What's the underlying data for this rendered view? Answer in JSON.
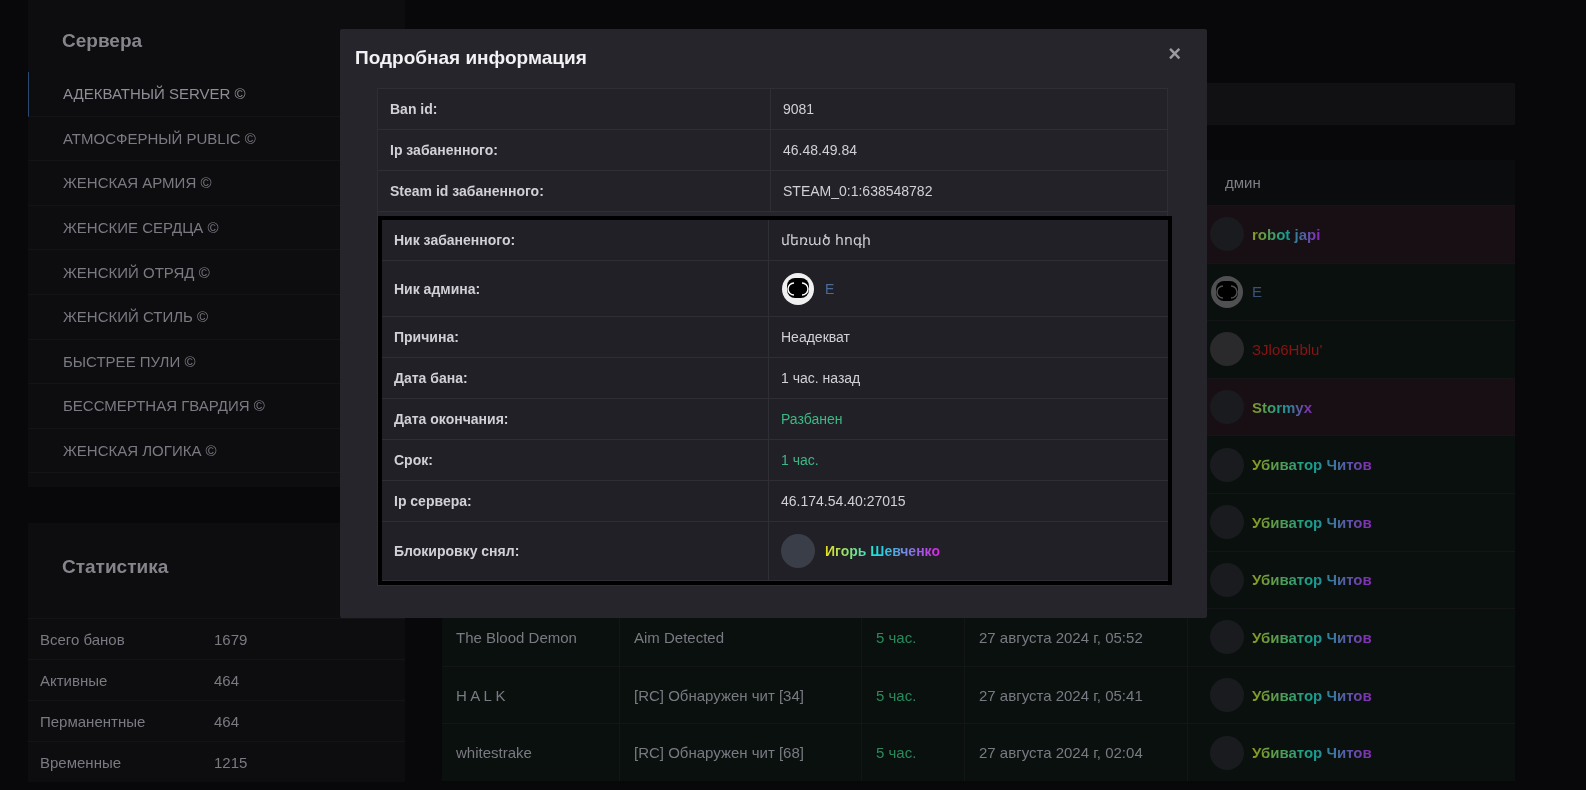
{
  "sidebar": {
    "servers": {
      "title": "Сервера",
      "items": [
        {
          "label": "АДЕКВАТНЫЙ SERVER ©",
          "selected": true
        },
        {
          "label": "АТМОСФЕРНЫЙ PUBLIC ©",
          "selected": false
        },
        {
          "label": "ЖЕНСКАЯ АРМИЯ ©",
          "selected": false
        },
        {
          "label": "ЖЕНСКИЕ СЕРДЦА ©",
          "selected": false
        },
        {
          "label": "ЖЕНСКИЙ ОТРЯД ©",
          "selected": false
        },
        {
          "label": "ЖЕНСКИЙ СТИЛЬ ©",
          "selected": false
        },
        {
          "label": "БЫСТРЕЕ ПУЛИ ©",
          "selected": false
        },
        {
          "label": "БЕССМЕРТНАЯ ГВАРДИЯ ©",
          "selected": false
        },
        {
          "label": "ЖЕНСКАЯ ЛОГИКА ©",
          "selected": false
        }
      ]
    },
    "stats": {
      "title": "Статистика",
      "rows": [
        {
          "label": "Всего банов",
          "value": "1679"
        },
        {
          "label": "Активные",
          "value": "464"
        },
        {
          "label": "Перманентные",
          "value": "464"
        },
        {
          "label": "Временные",
          "value": "1215"
        }
      ]
    }
  },
  "bans_table": {
    "columns": [
      "дмин"
    ],
    "rows": [
      {
        "active": true,
        "admin": {
          "name": "robot japi",
          "kind": "gradient"
        }
      },
      {
        "active": false,
        "admin": {
          "name": "E",
          "kind": "logo",
          "color": "#3a5276"
        }
      },
      {
        "active": false,
        "admin": {
          "name": "ЗJlо6Hblu'",
          "kind": "colored",
          "color": "#8a1414"
        }
      },
      {
        "active": true,
        "admin": {
          "name": "Stormyx",
          "kind": "gradient"
        }
      },
      {
        "active": false,
        "admin": {
          "name": "Убиватор Читов",
          "kind": "gradient"
        }
      },
      {
        "active": false,
        "admin": {
          "name": "Убиватор Читов",
          "kind": "gradient"
        }
      },
      {
        "active": false,
        "admin": {
          "name": "Убиватор Читов",
          "kind": "gradient"
        }
      },
      {
        "active": false,
        "player": "The Blood Demon",
        "reason": "Aim Detected",
        "term": "5 час.",
        "date": "27 августа 2024 г, 05:52",
        "admin": {
          "name": "Убиватор Читов",
          "kind": "gradient"
        }
      },
      {
        "active": false,
        "player": "H A L K",
        "reason": "[RC] Обнаружен чит [34]",
        "term": "5 час.",
        "date": "27 августа 2024 г, 05:41",
        "admin": {
          "name": "Убиватор Читов",
          "kind": "gradient"
        }
      },
      {
        "active": false,
        "player": "whitestrake",
        "reason": "[RC] Обнаружен чит [68]",
        "term": "5 час.",
        "date": "27 августа 2024 г, 02:04",
        "admin": {
          "name": "Убиватор Читов",
          "kind": "gradient"
        }
      }
    ]
  },
  "modal": {
    "title": "Подробная информация",
    "close": "×",
    "details": [
      {
        "label": "Ban id:",
        "kind": "text",
        "value": "9081",
        "highlighted": false
      },
      {
        "label": "Ip забаненного:",
        "kind": "text",
        "value": "46.48.49.84",
        "highlighted": false
      },
      {
        "label": "Steam id забаненного:",
        "kind": "text",
        "value": "STEAM_0:1:638548782",
        "highlighted": false
      },
      {
        "label": "Ник забаненного:",
        "kind": "text",
        "value": "մեռած հոգի",
        "highlighted": true
      },
      {
        "label": "Ник админа:",
        "kind": "logo-user",
        "value": "E",
        "color": "#4a6a9a",
        "highlighted": true
      },
      {
        "label": "Причина:",
        "kind": "text",
        "value": "Неадекват",
        "highlighted": true
      },
      {
        "label": "Дата бана:",
        "kind": "text",
        "value": "1 час. назад",
        "highlighted": true
      },
      {
        "label": "Дата окончания:",
        "kind": "status",
        "value": "Разбанен",
        "highlighted": true
      },
      {
        "label": "Срок:",
        "kind": "status",
        "value": "1 час.",
        "highlighted": true
      },
      {
        "label": "Ip сервера:",
        "kind": "text",
        "value": "46.174.54.40:27015",
        "highlighted": true
      },
      {
        "label": "Блокировку снял:",
        "kind": "photo-user",
        "value": "Игорь Шевченко",
        "highlighted": true
      }
    ]
  }
}
